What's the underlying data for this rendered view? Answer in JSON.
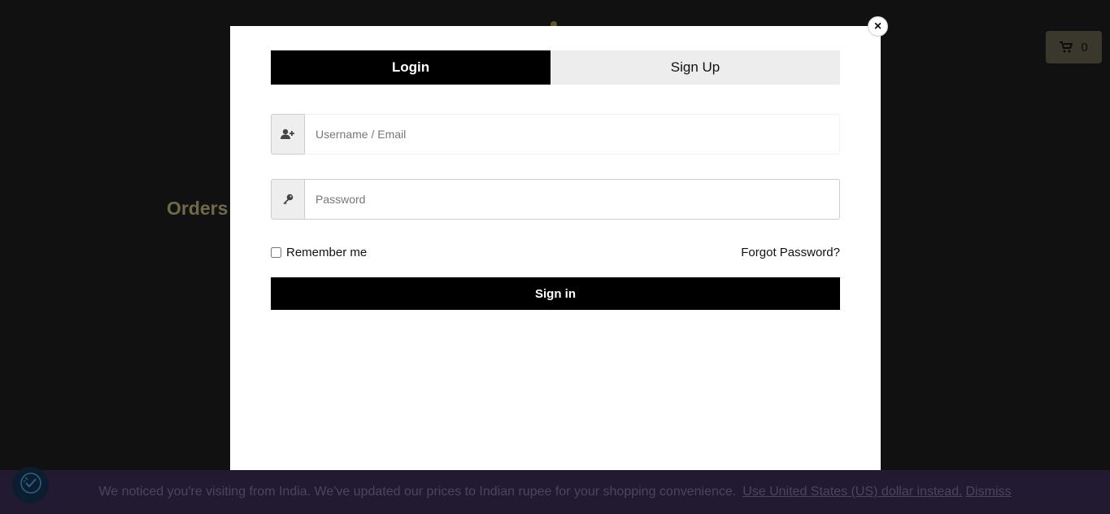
{
  "background": {
    "heading": "Orders",
    "cart": {
      "count": "0",
      "icon": "cart-icon"
    }
  },
  "notice": {
    "text": "We noticed you're visiting from India. We've updated our prices to Indian rupee for your shopping convenience.",
    "switch_link": "Use United States (US) dollar instead.",
    "dismiss_link": "Dismiss"
  },
  "modal": {
    "close_label": "×",
    "tabs": [
      {
        "label": "Login",
        "active": true
      },
      {
        "label": "Sign Up",
        "active": false
      }
    ],
    "username": {
      "placeholder": "Username / Email",
      "value": "",
      "icon": "user-plus-icon"
    },
    "password": {
      "placeholder": "Password",
      "value": "",
      "icon": "key-icon"
    },
    "remember_label": "Remember me",
    "remember_checked": false,
    "forgot_label": "Forgot Password?",
    "submit_label": "Sign in"
  },
  "colors": {
    "primary": "#000000",
    "tab_inactive": "#ededed",
    "notice_bg": "#221a30"
  }
}
